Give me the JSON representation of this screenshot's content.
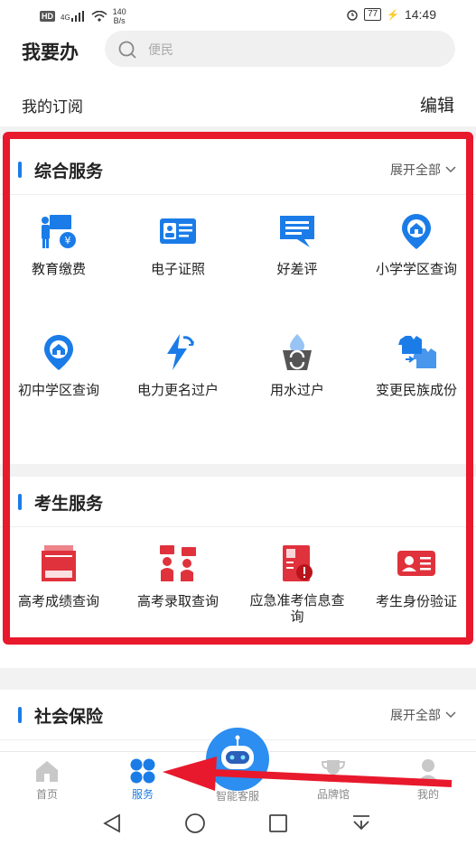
{
  "status": {
    "hd": "HD",
    "signal": "4G",
    "net_speed_value": "140",
    "net_speed_unit": "B/s",
    "battery": "77",
    "time": "14:49"
  },
  "header": {
    "title": "我要办",
    "search_placeholder": "便民"
  },
  "subscription": {
    "title": "我的订阅",
    "edit": "编辑"
  },
  "sections": [
    {
      "title": "综合服务",
      "expand": "展开全部",
      "items": [
        {
          "label": "教育缴费",
          "icon": "education-payment-icon"
        },
        {
          "label": "电子证照",
          "icon": "e-license-icon"
        },
        {
          "label": "好差评",
          "icon": "review-icon"
        },
        {
          "label": "小学学区查询",
          "icon": "primary-school-district-icon"
        },
        {
          "label": "初中学区查询",
          "icon": "middle-school-district-icon"
        },
        {
          "label": "电力更名过户",
          "icon": "electricity-transfer-icon"
        },
        {
          "label": "用水过户",
          "icon": "water-transfer-icon"
        },
        {
          "label": "变更民族成份",
          "icon": "ethnicity-change-icon"
        }
      ]
    },
    {
      "title": "考生服务",
      "items": [
        {
          "label": "高考成绩查询",
          "icon": "exam-score-icon"
        },
        {
          "label": "高考录取查询",
          "icon": "admission-query-icon"
        },
        {
          "label": "应急准考信息查询",
          "icon": "emergency-exam-info-icon"
        },
        {
          "label": "考生身份验证",
          "icon": "student-id-verify-icon"
        }
      ]
    },
    {
      "title": "社会保险",
      "expand": "展开全部"
    }
  ],
  "tabs": [
    {
      "label": "首页",
      "icon": "home-icon"
    },
    {
      "label": "服务",
      "icon": "services-icon",
      "active": true
    },
    {
      "label": "智能客服",
      "icon": "robot-icon"
    },
    {
      "label": "品牌馆",
      "icon": "trophy-icon"
    },
    {
      "label": "我的",
      "icon": "profile-icon"
    }
  ],
  "colors": {
    "accent": "#1b7ce8",
    "exam_red": "#e0323c",
    "annotation_red": "#e8192c"
  }
}
